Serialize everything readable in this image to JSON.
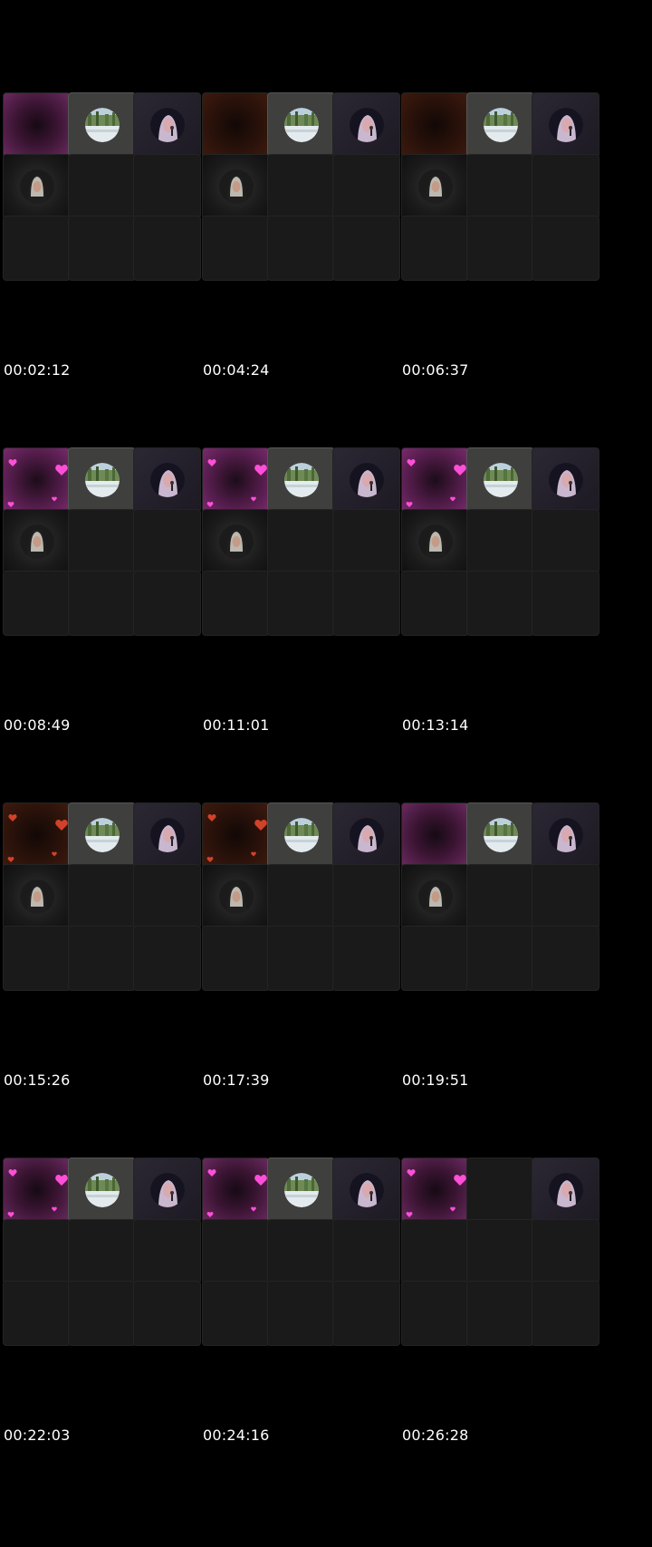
{
  "timestamps": [
    "00:02:12",
    "00:04:24",
    "00:06:37",
    "00:08:49",
    "00:11:01",
    "00:13:14",
    "00:15:26",
    "00:17:39",
    "00:19:51",
    "00:22:03",
    "00:24:16",
    "00:26:28"
  ],
  "frames": [
    {
      "tile1": "pink",
      "hearts": false,
      "landscape": true,
      "nun": true
    },
    {
      "tile1": "amber",
      "hearts": false,
      "landscape": true,
      "nun": true
    },
    {
      "tile1": "amber",
      "hearts": false,
      "landscape": true,
      "nun": true
    },
    {
      "tile1": "pink-bright",
      "hearts": true,
      "landscape": true,
      "nun": true
    },
    {
      "tile1": "pink-bright",
      "hearts": true,
      "landscape": true,
      "nun": true
    },
    {
      "tile1": "pink-bright",
      "hearts": true,
      "landscape": true,
      "nun": true
    },
    {
      "tile1": "amber",
      "hearts": true,
      "landscape": true,
      "nun": true
    },
    {
      "tile1": "amber",
      "hearts": true,
      "landscape": true,
      "nun": true
    },
    {
      "tile1": "pink",
      "hearts": false,
      "landscape": true,
      "nun": true
    },
    {
      "tile1": "pink",
      "hearts": true,
      "landscape": true,
      "nun": false
    },
    {
      "tile1": "pink",
      "hearts": true,
      "landscape": true,
      "nun": false
    },
    {
      "tile1": "pink",
      "hearts": true,
      "landscape": false,
      "nun": false
    }
  ],
  "icons": {
    "landscape": "landscape-avatar-icon",
    "singer": "singer-avatar-icon",
    "nun": "nun-avatar-icon",
    "heart": "heart-icon"
  },
  "colors": {
    "background": "#000000",
    "tile": "#1a1a1a",
    "timestamp": "#ffffff",
    "heart": "#ff4fd8"
  }
}
